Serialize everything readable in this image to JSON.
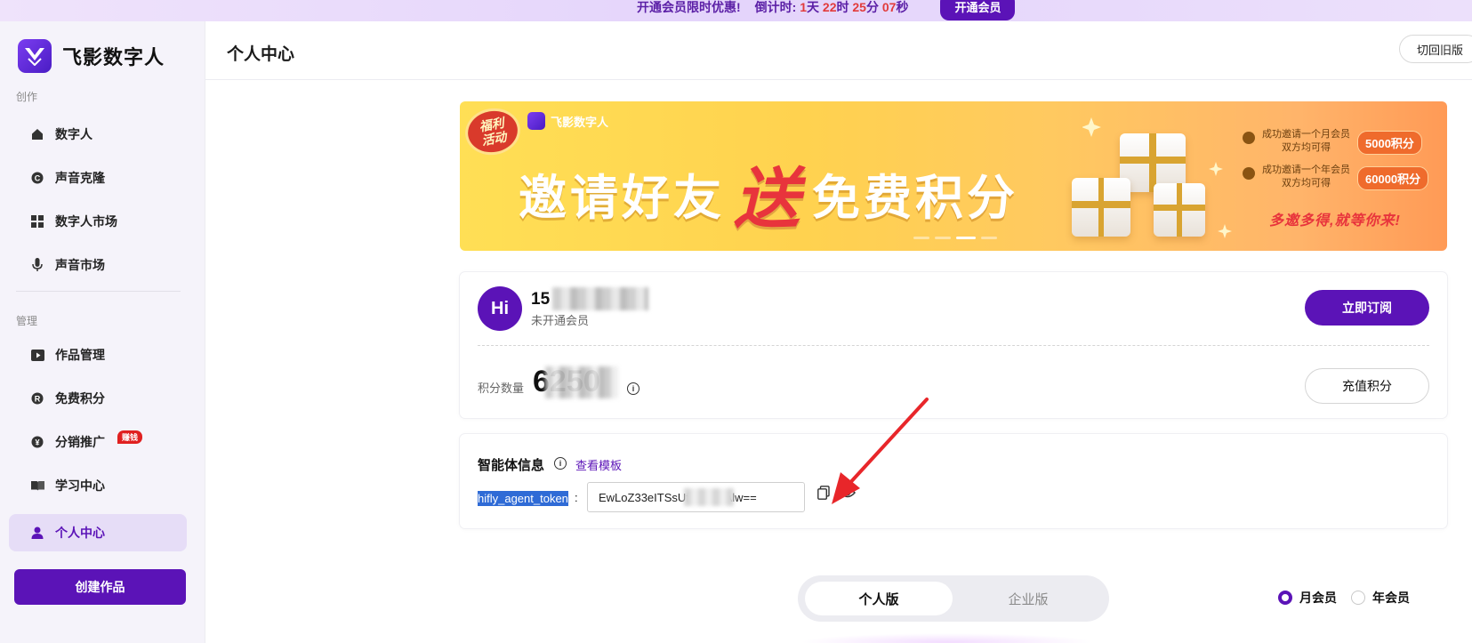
{
  "promo": {
    "offer_text": "开通会员限时优惠!",
    "countdown_prefix": "倒计时:",
    "days": "1",
    "days_unit": "天",
    "hours": "22",
    "hours_unit": "时",
    "minutes": "25",
    "minutes_unit": "分",
    "seconds": "07",
    "seconds_unit": "秒",
    "button_label": "开通会员"
  },
  "brand": {
    "name": "飞影数字人"
  },
  "sidebar": {
    "section_create": "创作",
    "section_manage": "管理",
    "items": [
      {
        "label": "数字人",
        "icon": "home-icon"
      },
      {
        "label": "声音克隆",
        "icon": "voice-clone-icon"
      },
      {
        "label": "数字人市场",
        "icon": "grid-icon"
      },
      {
        "label": "声音市场",
        "icon": "microphone-icon"
      },
      {
        "label": "作品管理",
        "icon": "video-icon"
      },
      {
        "label": "免费积分",
        "icon": "points-icon"
      },
      {
        "label": "分销推广",
        "icon": "yen-icon",
        "badge": "赚钱"
      },
      {
        "label": "学习中心",
        "icon": "book-icon"
      },
      {
        "label": "个人中心",
        "icon": "user-icon",
        "active": true
      }
    ],
    "create_button": "创建作品"
  },
  "header": {
    "title": "个人中心",
    "old_version_button": "切回旧版"
  },
  "banner": {
    "badge_line1": "福利",
    "badge_line2": "活动",
    "brand": "飞影数字人",
    "title_left": "邀请好友",
    "title_mid": "送",
    "title_right": "免费积分",
    "reward1_text_line1": "成功邀请一个月会员",
    "reward1_text_line2": "双方均可得",
    "reward1_points": "5000积分",
    "reward2_text_line1": "成功邀请一个年会员",
    "reward2_text_line2": "双方均可得",
    "reward2_points": "60000积分",
    "slogan": "多邀多得,就等你来!",
    "slide_count": 4,
    "active_slide": 3
  },
  "account": {
    "avatar_text": "Hi",
    "user_name_visible": "15",
    "tier": "未开通会员",
    "subscribe_button": "立即订阅",
    "points_label": "积分数量",
    "points_value_visible": "6250",
    "recharge_button": "充值积分"
  },
  "agent": {
    "title": "智能体信息",
    "template_link": "查看模板",
    "token_label": "hifly_agent_token",
    "token_colon": ":",
    "token_value": "EwLoZ33eITSsUf          /Alw=="
  },
  "plans": {
    "tab_personal": "个人版",
    "tab_enterprise": "企业版",
    "billing_monthly": "月会员",
    "billing_yearly": "年会员"
  },
  "colors": {
    "accent": "#5b13b7",
    "sidebar_bg": "#f5f3fa",
    "active_item_bg": "#e6ddf7",
    "annotation_arrow": "#e8262a"
  }
}
